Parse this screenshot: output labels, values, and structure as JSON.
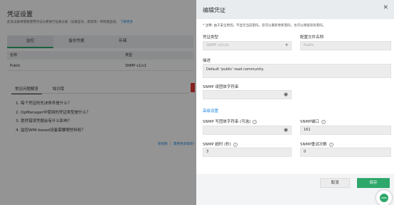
{
  "background": {
    "title": "凭证设置",
    "desc": "此处设备将需要使用凭证以便进行设备分类（设备型号、类别等）和性能监视。",
    "desc_link": "了解更多",
    "tabs": [
      "监控",
      "备份凭据",
      "存储"
    ],
    "table": {
      "col_name": "名称",
      "col_type": "类型",
      "row_name": "Public",
      "row_type": "SNMP v1/v2"
    },
    "faq_tabs": [
      "常见问题解答",
      "知识库"
    ],
    "faq_items": [
      "1. 每个凭证的先决条件是什么？",
      "2. OpManager中使用的凭证类型是什么？",
      "3. 提供错误凭据会有什么影响？",
      "4. 监控WMI-based设备需要哪些特权？"
    ],
    "footer_link1": "新视图",
    "footer_link2": "需要更多帮助？"
  },
  "modal": {
    "title": "编辑凭证",
    "close_icon": "close-icon",
    "note": "* 注释: 由于安全原因，不显示当前密码。您可以重新更新密码，也可以保留现有密码。",
    "cred_type_label": "凭证类型",
    "cred_type_value": "SNMP v1/v2c",
    "profile_label": "配置文件名称",
    "profile_value": "Public",
    "desc_label": "描述",
    "desc_value": "Default 'public' read community.",
    "read_label": "SNMP 读团体字符串",
    "read_value": "",
    "advanced_link": "高级设置",
    "write_label": "SNMP 写团体字符串 (可选)",
    "write_value": "",
    "port_label": "SNMP端口",
    "port_value": "161",
    "timeout_label": "SNMP 超时 (秒)",
    "timeout_value": "3",
    "retry_label": "SNMP重试次数",
    "retry_value": "0",
    "cancel_label": "取消",
    "save_label": "保存"
  },
  "colors": {
    "accent": "#2ea76b",
    "link": "#1e88e5",
    "danger": "#e53935"
  }
}
